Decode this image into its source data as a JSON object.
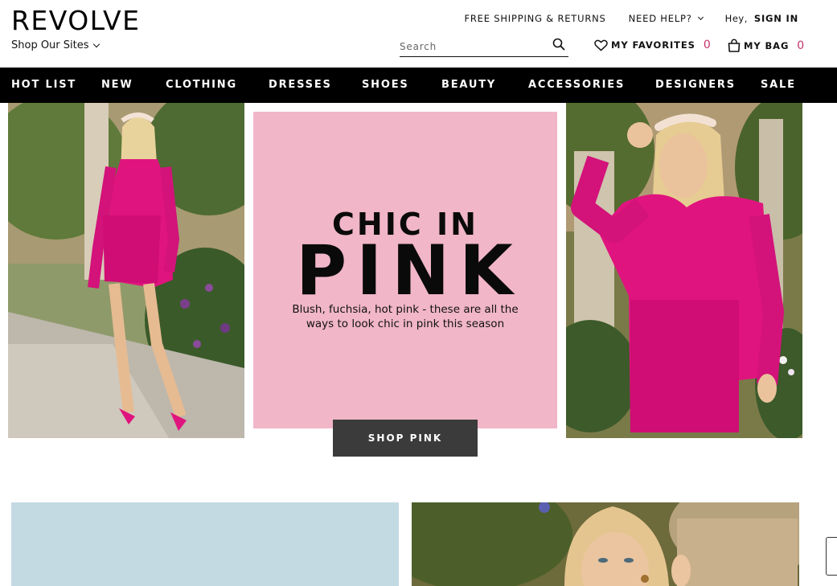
{
  "header": {
    "logo": "REVOLVE",
    "shop_sites": "Shop Our Sites",
    "free_shipping": "FREE SHIPPING & RETURNS",
    "need_help": "NEED HELP?",
    "hey": "Hey,",
    "sign_in": "SIGN IN",
    "search_placeholder": "Search",
    "favorites_label": "MY FAVORITES",
    "favorites_count": "0",
    "bag_label": "MY BAG",
    "bag_count": "0"
  },
  "nav": {
    "items": [
      "HOT LIST",
      "NEW",
      "CLOTHING",
      "DRESSES",
      "SHOES",
      "BEAUTY",
      "ACCESSORIES",
      "DESIGNERS",
      "SALE"
    ]
  },
  "promo": {
    "title_top": "CHIC IN",
    "title_big": "PINK",
    "description": "Blush, fuchsia, hot pink - these are all the ways to look chic in pink this season",
    "button": "SHOP PINK"
  },
  "colors": {
    "promo_bg": "#f1b6c8",
    "accent_count": "#c5326a",
    "nav_bg": "#000000",
    "button_bg": "#3b3b3b",
    "tile_blue": "#c3dae3"
  }
}
